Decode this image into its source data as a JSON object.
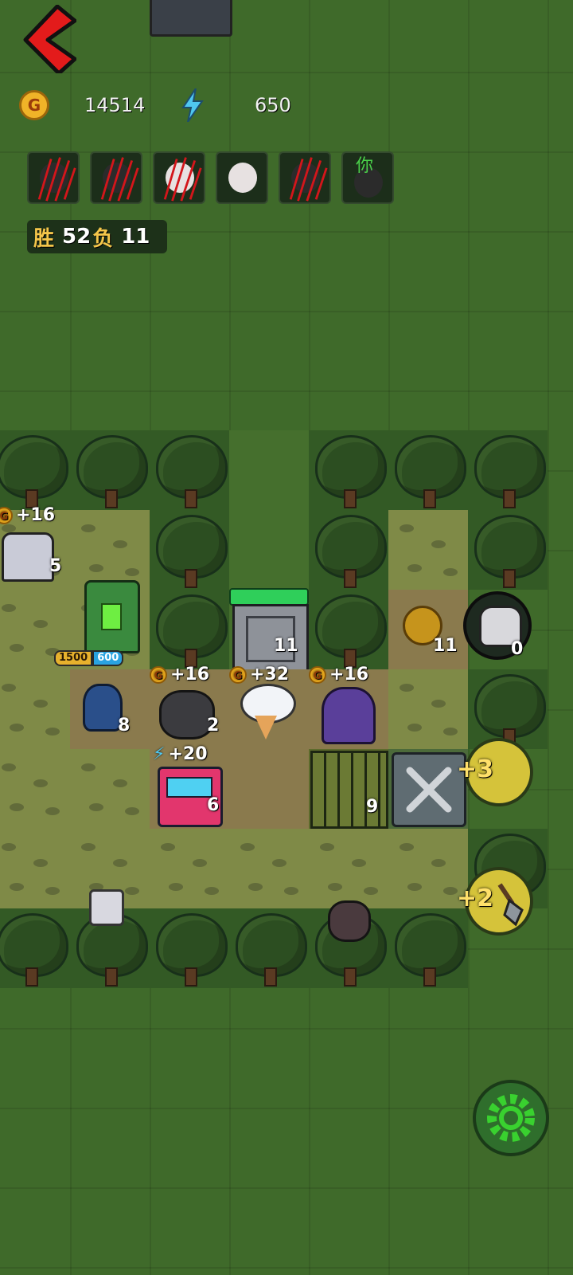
{
  "hud": {
    "coins": "14514",
    "coin_icon_letter": "G",
    "energy": "650"
  },
  "opponents": [
    {
      "status": "defeated",
      "face": "dark"
    },
    {
      "status": "defeated",
      "face": "dark"
    },
    {
      "status": "defeated",
      "face": "white"
    },
    {
      "status": "active",
      "face": "white"
    },
    {
      "status": "defeated",
      "face": "dark"
    },
    {
      "status": "you",
      "face": "dark",
      "label": "你"
    }
  ],
  "record": {
    "win_label": "胜",
    "wins": "52",
    "loss_label": "负",
    "losses": "11"
  },
  "board": {
    "bed_yield": "+16",
    "bed_level": "5",
    "trash_cost_coins": "1500",
    "trash_cost_energy": "600",
    "door_level": "11",
    "quill_level": "11",
    "monster_count": "0",
    "sapphire_level": "8",
    "ore_yield": "+16",
    "ore_level": "2",
    "icecream_yield": "+32",
    "ghost_yield": "+16",
    "arcade_yield": "+20",
    "arcade_level": "6",
    "cage_level": "9",
    "coin_boost": "+3",
    "shovel_boost": "+2"
  },
  "colors": {
    "grass": "#3f6a2a",
    "accent_gold": "#f4c64a",
    "energy_blue": "#4fc7f0",
    "settings_green": "#39d12f"
  }
}
